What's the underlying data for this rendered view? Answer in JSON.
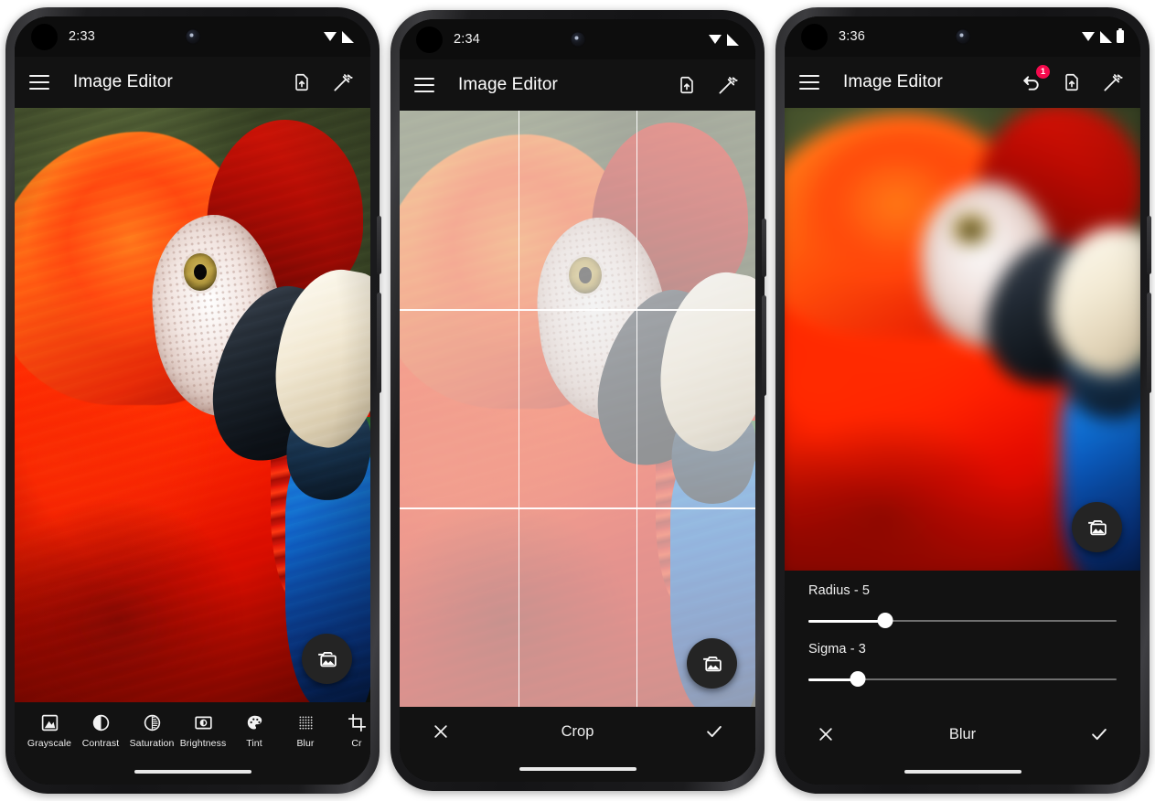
{
  "app": {
    "title": "Image Editor"
  },
  "phones": [
    {
      "id": "phone-editor",
      "status": {
        "time": "2:33",
        "wifi": "wifi-icon",
        "signal": "signal-icon",
        "battery": null
      },
      "appbar": {
        "menu": "menu-icon",
        "title": "Image Editor",
        "actions": [
          "save-file-icon",
          "magic-wand-icon"
        ],
        "undo_badge": null
      },
      "fab": {
        "icon": "photo-library-icon",
        "label": "Pick image"
      },
      "mode": "filters",
      "filters": [
        {
          "label": "Grayscale",
          "icon": "grayscale-icon"
        },
        {
          "label": "Contrast",
          "icon": "contrast-icon"
        },
        {
          "label": "Saturation",
          "icon": "saturation-icon"
        },
        {
          "label": "Brightness",
          "icon": "brightness-icon"
        },
        {
          "label": "Tint",
          "icon": "palette-icon"
        },
        {
          "label": "Blur",
          "icon": "blur-grid-icon"
        },
        {
          "label": "Cr",
          "icon": "crop-icon"
        }
      ]
    },
    {
      "id": "phone-crop",
      "status": {
        "time": "2:34",
        "wifi": "wifi-icon",
        "signal": "signal-icon",
        "battery": null
      },
      "appbar": {
        "menu": "menu-icon",
        "title": "Image Editor",
        "actions": [
          "save-file-icon",
          "magic-wand-icon"
        ],
        "undo_badge": null
      },
      "fab": {
        "icon": "photo-library-icon",
        "label": "Pick image"
      },
      "mode": "crop",
      "actionbar": {
        "cancel": "close-icon",
        "title": "Crop",
        "confirm": "check-icon"
      }
    },
    {
      "id": "phone-blur",
      "status": {
        "time": "3:36",
        "wifi": "wifi-icon",
        "signal": "signal-icon",
        "battery": "battery-icon"
      },
      "appbar": {
        "menu": "menu-icon",
        "title": "Image Editor",
        "actions": [
          "undo-icon",
          "save-file-icon",
          "magic-wand-icon"
        ],
        "undo_badge": "1"
      },
      "fab": {
        "icon": "photo-library-icon",
        "label": "Pick image"
      },
      "mode": "blur",
      "sliders": [
        {
          "label": "Radius - 5",
          "name": "radius",
          "value": 5,
          "percent": 25
        },
        {
          "label": "Sigma - 3",
          "name": "sigma",
          "value": 3,
          "percent": 16
        }
      ],
      "actionbar": {
        "cancel": "close-icon",
        "title": "Blur",
        "confirm": "check-icon"
      }
    }
  ],
  "colors": {
    "surface": "#121212",
    "statusbar": "#0d0d0d",
    "badge": "#f50a4d",
    "text": "#ffffff",
    "slider_active": "#ffffff",
    "slider_rail": "#6f6f6f",
    "fab": "#242424"
  }
}
